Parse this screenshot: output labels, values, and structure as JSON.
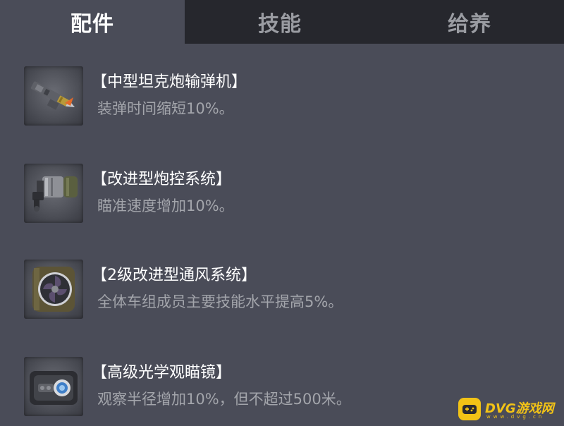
{
  "tabs": [
    {
      "label": "配件",
      "active": true
    },
    {
      "label": "技能",
      "active": false
    },
    {
      "label": "给养",
      "active": false
    }
  ],
  "items": [
    {
      "title": "【中型坦克炮输弹机】",
      "desc": "装弹时间缩短10%。",
      "icon": "rammer-icon"
    },
    {
      "title": "【改进型炮控系统】",
      "desc": "瞄准速度增加10%。",
      "icon": "gun-laying-drive-icon"
    },
    {
      "title": "【2级改进型通风系统】",
      "desc": "全体车组成员主要技能水平提高5%。",
      "icon": "ventilation-fan-icon"
    },
    {
      "title": "【高级光学观瞄镜】",
      "desc": "观察半径增加10%，但不超过500米。",
      "icon": "coated-optics-icon"
    }
  ],
  "watermark": {
    "brand": "DVG游戏网",
    "domain": "www.dvg.cn"
  },
  "colors": {
    "background": "#4a4c58",
    "tab_bar": "#26272d",
    "title_text": "#ffffff",
    "desc_text": "#a3a5ab",
    "watermark": "#f2c316"
  }
}
